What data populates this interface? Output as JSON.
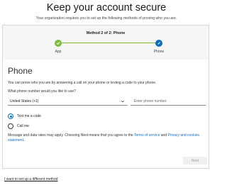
{
  "header": {
    "title": "Keep your account secure",
    "subtitle": "Your organization requires you to set up the following methods of proving who you are."
  },
  "progress": {
    "label": "Method 2 of 2: Phone",
    "steps": [
      {
        "name": "App",
        "state": "complete"
      },
      {
        "name": "Phone",
        "state": "current"
      }
    ],
    "colors": {
      "complete": "#7dbb3e",
      "current": "#0f6cbd"
    }
  },
  "phone_form": {
    "title": "Phone",
    "description": "You can prove who you are by answering a call on your phone or texting a code to your phone.",
    "question": "What phone number would you like to use?",
    "country_selected": "United States (+1)",
    "phone_placeholder": "Enter phone number",
    "options": [
      {
        "label": "Text me a code",
        "checked": true
      },
      {
        "label": "Call me",
        "checked": false
      }
    ],
    "legal_prefix": "Message and data rates may apply. Choosing Next means that you agree to the ",
    "terms_link": "Terms of service",
    "legal_and": " and ",
    "privacy_link": "Privacy and cookies statement",
    "legal_suffix": ".",
    "next_label": "Next"
  },
  "footer": {
    "alt_method_link": "I want to set up a different method"
  }
}
